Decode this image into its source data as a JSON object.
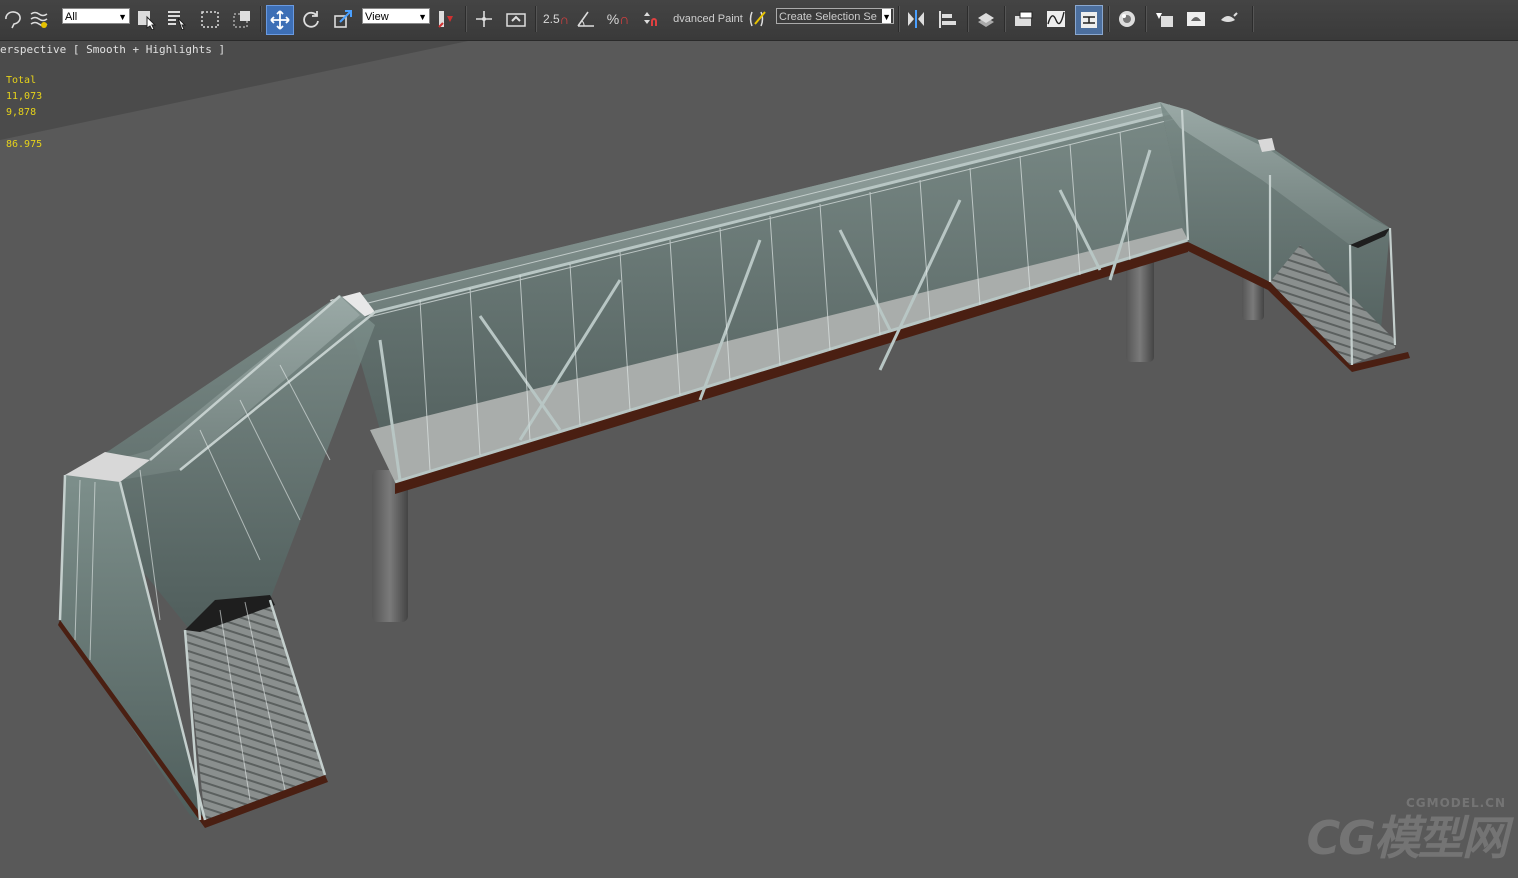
{
  "toolbar": {
    "selection_filter": "All",
    "ref_coord": "View",
    "snap_angle": "2.5",
    "paint_label": "dvanced Paint",
    "named_sel": "Create Selection Se",
    "icons": [
      "lasso-icon",
      "chain-icon",
      "select-object-icon",
      "select-by-name-icon",
      "rect-region-icon",
      "window-crossing-icon",
      "move-icon",
      "rotate-icon",
      "scale-icon",
      "pivot-icon",
      "manipulate-icon",
      "keyboard-shortcut-icon",
      "snap-toggle-icon",
      "angle-snap-icon",
      "percent-snap-icon",
      "spinner-snap-icon",
      "edit-named-sel-icon",
      "mirror-icon",
      "align-icon",
      "layer-icon",
      "ribbon-icon",
      "curve-editor-icon",
      "schematic-icon",
      "material-editor-icon",
      "render-setup-icon",
      "rendered-frame-icon",
      "render-icon"
    ]
  },
  "viewport": {
    "label": "erspective [ Smooth + Highlights ]",
    "stats": {
      "total_label": "Total",
      "polys": "11,073",
      "verts": "9,878",
      "fps": "86.975"
    }
  },
  "watermark": {
    "main": "CG模型网",
    "sub": "CGMODEL.CN"
  },
  "colors": {
    "toolbar_bg": "#3e3e3e",
    "viewport_bg": "#595959",
    "stat_yellow": "#e6d21a",
    "active_blue": "#3d6fb6"
  }
}
